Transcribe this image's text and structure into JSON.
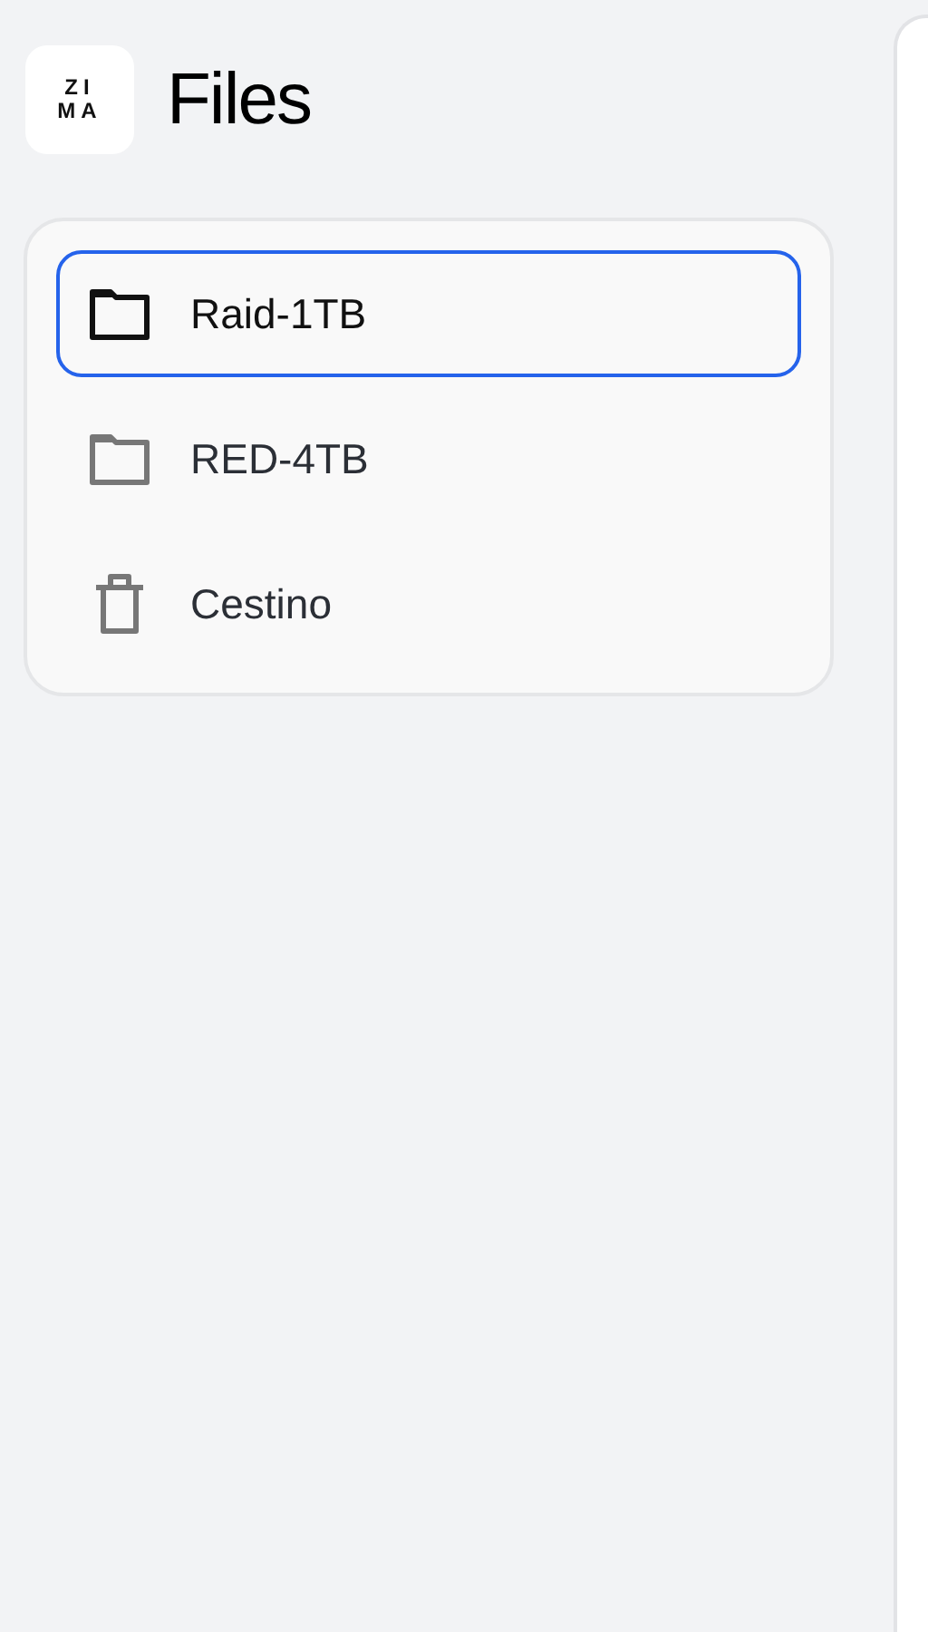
{
  "app": {
    "logo": {
      "lines": [
        "ZI",
        "MA"
      ]
    },
    "title": "Files"
  },
  "sidebar": {
    "items": [
      {
        "kind": "folder",
        "label": "Raid-1TB",
        "selected": true
      },
      {
        "kind": "folder",
        "label": "RED-4TB",
        "selected": false
      },
      {
        "kind": "trash",
        "label": "Cestino",
        "selected": false
      }
    ]
  }
}
